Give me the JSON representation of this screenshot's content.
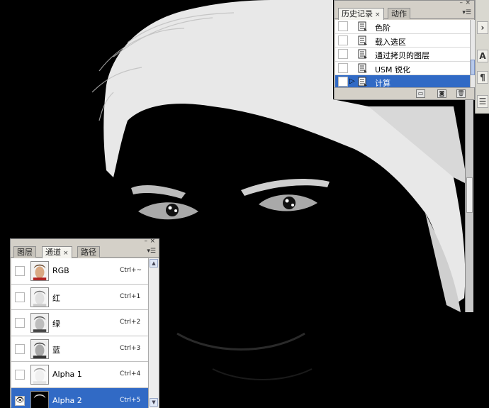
{
  "history_panel": {
    "tabs": [
      {
        "label": "历史记录",
        "active": true
      },
      {
        "label": "动作",
        "active": false
      }
    ],
    "items": [
      {
        "label": "色阶"
      },
      {
        "label": "载入选区"
      },
      {
        "label": "通过拷贝的图层"
      },
      {
        "label": "USM 锐化"
      },
      {
        "label": "计算",
        "selected": true
      }
    ]
  },
  "channels_panel": {
    "tabs": [
      {
        "label": "图层",
        "active": false
      },
      {
        "label": "通道",
        "active": true
      },
      {
        "label": "路径",
        "active": false
      }
    ],
    "channels": [
      {
        "name": "RGB",
        "shortcut": "Ctrl+~",
        "visible": false
      },
      {
        "name": "红",
        "shortcut": "Ctrl+1",
        "visible": false
      },
      {
        "name": "绿",
        "shortcut": "Ctrl+2",
        "visible": false
      },
      {
        "name": "蓝",
        "shortcut": "Ctrl+3",
        "visible": false
      },
      {
        "name": "Alpha 1",
        "shortcut": "Ctrl+4",
        "visible": false
      },
      {
        "name": "Alpha 2",
        "shortcut": "Ctrl+5",
        "visible": true,
        "selected": true
      }
    ]
  },
  "toolstrip": {
    "buttons": [
      "A",
      "¶"
    ]
  },
  "colors": {
    "selection": "#316ac5",
    "panel_bg": "#d4d0c8",
    "canvas_bg": "#000000"
  }
}
